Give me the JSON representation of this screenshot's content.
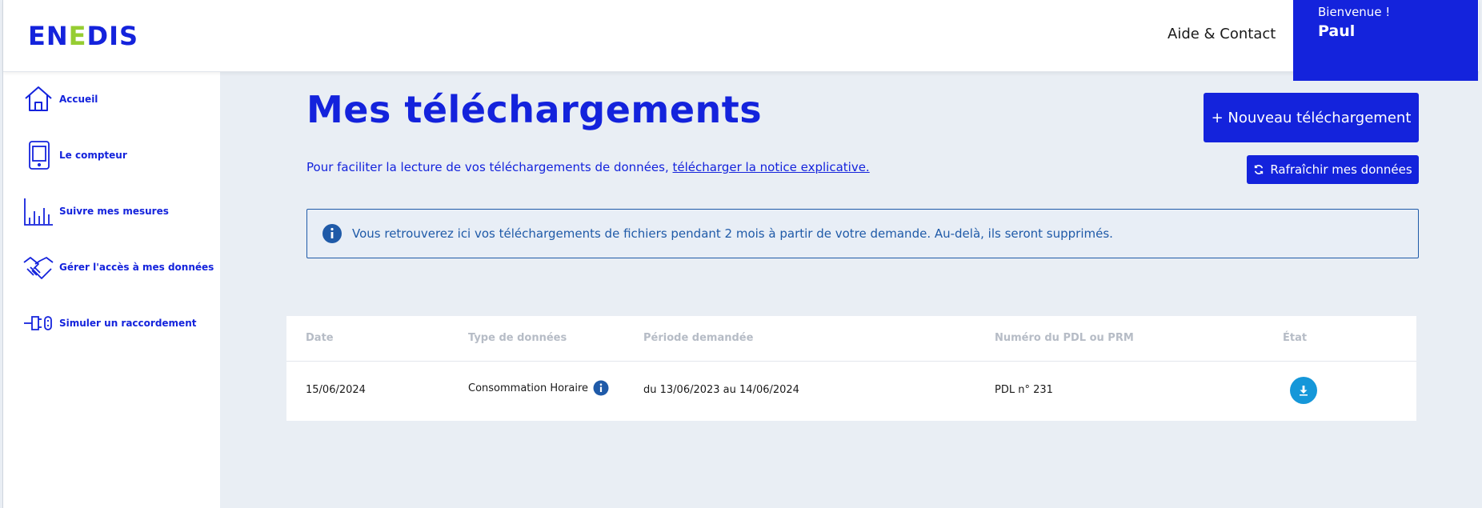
{
  "header": {
    "logo_text": "ENEDIS",
    "help_link": "Aide & Contact",
    "welcome_label": "Bienvenue !",
    "user_name": "Paul"
  },
  "sidebar": {
    "items": [
      {
        "label": "Accueil",
        "icon": "home-icon"
      },
      {
        "label": "Le compteur",
        "icon": "meter-icon"
      },
      {
        "label": "Suivre mes mesures",
        "icon": "bar-chart-icon"
      },
      {
        "label": "Gérer l'accès à mes données",
        "icon": "handshake-icon"
      },
      {
        "label": "Simuler un raccordement",
        "icon": "plug-icon"
      }
    ]
  },
  "main": {
    "title": "Mes téléchargements",
    "intro_text": "Pour faciliter la lecture de vos téléchargements de données, ",
    "intro_link": "télécharger la notice explicative.",
    "new_download_button": "+ Nouveau téléchargement",
    "refresh_button": "Rafraîchir mes données",
    "info_message": "Vous retrouverez ici vos téléchargements de fichiers pendant 2 mois à partir de votre demande. Au-delà, ils seront supprimés."
  },
  "table": {
    "headers": [
      "Date",
      "Type de données",
      "Période demandée",
      "Numéro du PDL ou PRM",
      "État"
    ],
    "rows": [
      {
        "date": "15/06/2024",
        "type": "Consommation Horaire",
        "period": "du 13/06/2023 au 14/06/2024",
        "pdl": "PDL n° 231",
        "state_icon": "download-icon"
      }
    ]
  },
  "colors": {
    "brand_blue": "#1423dc",
    "brand_green": "#96cd32",
    "info_blue": "#1f5aa8",
    "download_blue": "#1597d9",
    "page_bg": "#e9eef4"
  }
}
